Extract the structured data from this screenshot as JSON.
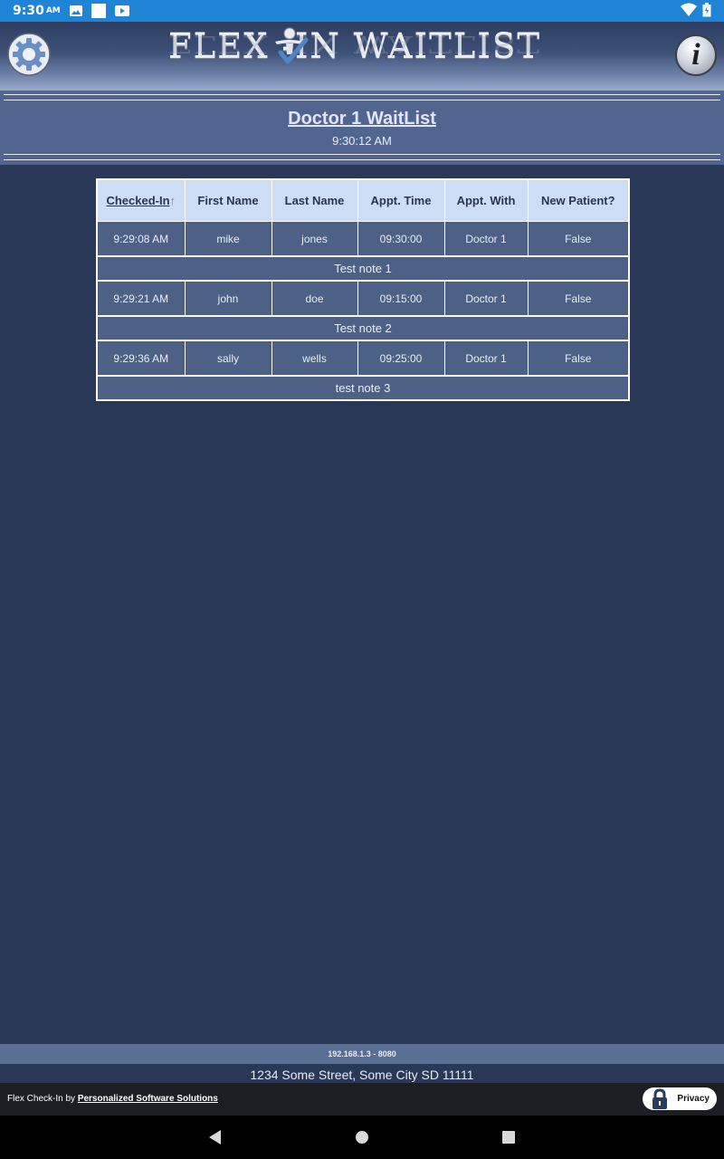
{
  "status_bar": {
    "time": "9:30",
    "ampm": "AM",
    "icons": [
      "image-icon",
      "square-icon",
      "youtube-icon",
      "wifi-icon",
      "battery-icon"
    ]
  },
  "header": {
    "logo_text": "FLEX   -IN WAITLIST",
    "settings_icon": "gear-icon",
    "info_icon_glyph": "i"
  },
  "title_band": {
    "title": "Doctor 1 WaitList",
    "time": "9:30:12 AM"
  },
  "table": {
    "columns": [
      "Checked-In",
      "First Name",
      "Last Name",
      "Appt. Time",
      "Appt. With",
      "New Patient?"
    ],
    "sort_arrow": "↑",
    "rows": [
      {
        "cells": [
          "9:29:08 AM",
          "mike",
          "jones",
          "09:30:00",
          "Doctor 1",
          "False"
        ],
        "note": "Test note 1"
      },
      {
        "cells": [
          "9:29:21 AM",
          "john",
          "doe",
          "09:15:00",
          "Doctor 1",
          "False"
        ],
        "note": "Test note 2"
      },
      {
        "cells": [
          "9:29:36 AM",
          "sally",
          "wells",
          "09:25:00",
          "Doctor 1",
          "False"
        ],
        "note": "test note 3"
      }
    ]
  },
  "footer": {
    "ip": "192.168.1.3 - 8080",
    "address": "1234 Some Street, Some City SD 11111",
    "credit_prefix": "Flex Check-In by",
    "credit_link": "Personalized Software Solutions",
    "privacy_label": "Privacy"
  },
  "colors": {
    "background": "#293857",
    "title_band": "#526591",
    "header_cell": "#cdddf5",
    "body_cell": "#4d6086",
    "status_bar": "#1f84d6"
  }
}
